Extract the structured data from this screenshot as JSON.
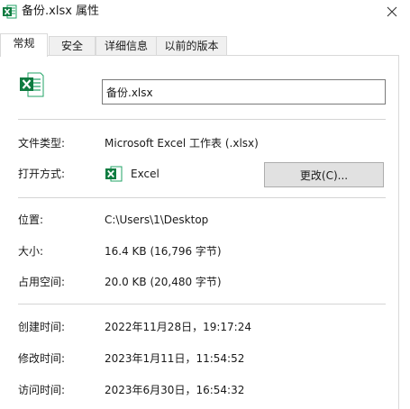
{
  "window": {
    "title": "备份.xlsx 属性"
  },
  "tabs": [
    {
      "label": "常规",
      "active": true
    },
    {
      "label": "安全",
      "active": false
    },
    {
      "label": "详细信息",
      "active": false
    },
    {
      "label": "以前的版本",
      "active": false
    }
  ],
  "general": {
    "filename": "备份.xlsx",
    "file_type_label": "文件类型:",
    "file_type_value": "Microsoft Excel 工作表 (.xlsx)",
    "opens_with_label": "打开方式:",
    "opens_with_app": "Excel",
    "change_button": "更改(C)...",
    "location_label": "位置:",
    "location_value": "C:\\Users\\1\\Desktop",
    "size_label": "大小:",
    "size_value": "16.4 KB (16,796 字节)",
    "size_on_disk_label": "占用空间:",
    "size_on_disk_value": "20.0 KB (20,480 字节)",
    "created_label": "创建时间:",
    "created_value": "2022年11月28日，19:17:24",
    "modified_label": "修改时间:",
    "modified_value": "2023年1月11日，11:54:52",
    "accessed_label": "访问时间:",
    "accessed_value": "2023年6月30日，16:54:32"
  },
  "icons": {
    "title_icon": "excel-icon",
    "close_icon": "close-icon",
    "file_icon": "excel-file-icon",
    "app_icon": "excel-app-icon"
  },
  "colors": {
    "excel_green": "#107c41",
    "background": "#ffffff",
    "button_face": "#e1e1e1"
  }
}
